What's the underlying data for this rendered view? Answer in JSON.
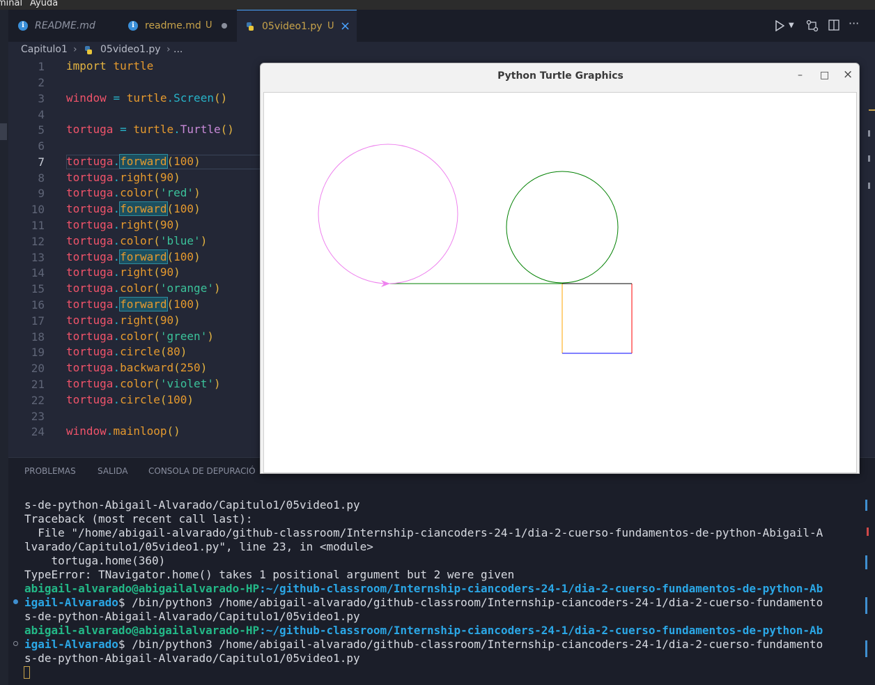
{
  "menubar": {
    "items": [
      "minal",
      "Ayuda"
    ]
  },
  "tabs": [
    {
      "label": "README.md",
      "modified": ""
    },
    {
      "label": "readme.md",
      "modified": "U"
    },
    {
      "label": "05video1.py",
      "modified": "U"
    }
  ],
  "breadcrumb": {
    "folder": "Capitulo1",
    "file": "05video1.py",
    "more": "..."
  },
  "editor": {
    "line_numbers": [
      "1",
      "2",
      "3",
      "4",
      "5",
      "6",
      "7",
      "8",
      "9",
      "10",
      "11",
      "12",
      "13",
      "14",
      "15",
      "16",
      "17",
      "18",
      "19",
      "20",
      "21",
      "22",
      "23",
      "24"
    ],
    "current_line": 7
  },
  "panel": {
    "tabs": [
      "PROBLEMAS",
      "SALIDA",
      "CONSOLA DE DEPURACIÓ"
    ],
    "terminal": [
      "s-de-python-Abigail-Alvarado/Capitulo1/05video1.py",
      "Traceback (most recent call last):",
      "  File \"/home/abigail-alvarado/github-classroom/Internship-ciancoders-24-1/dia-2-cuerso-fundamentos-de-python-Abigail-A",
      "lvarado/Capitulo1/05video1.py\", line 23, in <module>",
      "    tortuga.home(360)",
      "TypeError: TNavigator.home() takes 1 positional argument but 2 were given"
    ],
    "prompt_user": "abigail-alvarado@abigailalvarado-HP",
    "prompt_path_1": ":~/github-classroom/Internship-ciancoders-24-1/dia-2-cuerso-fundamentos-de-python-Ab",
    "prompt_path_2": "igail-Alvarado",
    "command_1": "$ /bin/python3 /home/abigail-alvarado/github-classroom/Internship-ciancoders-24-1/dia-2-cuerso-fundamento",
    "command_2": "s-de-python-Abigail-Alvarado/Capitulo1/05video1.py"
  },
  "turtle_window": {
    "title": "Python Turtle Graphics",
    "minimize_symbol": "–",
    "maximize_symbol": "□",
    "close_symbol": "×"
  },
  "colors": {
    "accent": "#4aa3ff",
    "terminal_user": "#23b887",
    "terminal_path": "#2ba7e6",
    "stroke_violet": "#ee82ee",
    "stroke_green": "#008000",
    "stroke_red": "#ff0000",
    "stroke_blue": "#0000ff",
    "stroke_orange": "#ffa500"
  },
  "icons": [
    "info-icon",
    "python-icon",
    "close-icon",
    "run-icon",
    "chevron-down-icon",
    "source-control-icon",
    "split-editor-icon",
    "more-icon"
  ]
}
